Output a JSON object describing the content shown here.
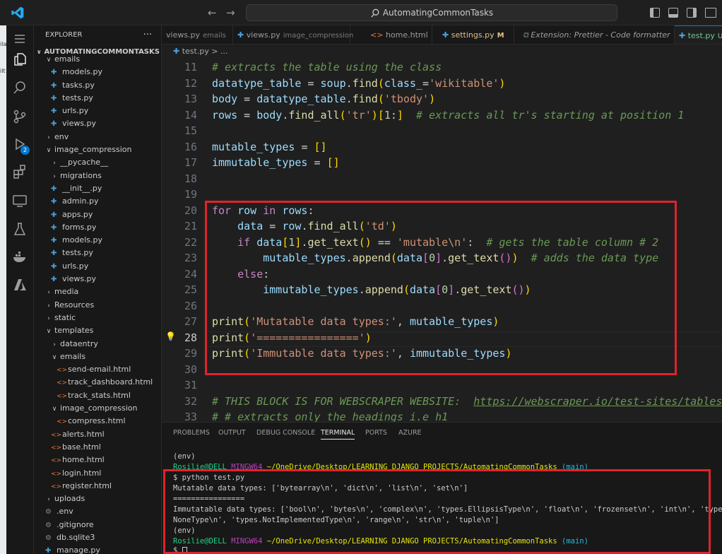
{
  "titlebar": {
    "search_text": "AutomatingCommonTasks",
    "back": "←",
    "forward": "→"
  },
  "left_strip": [
    "ila",
    "ilt"
  ],
  "explorer": {
    "header": "EXPLORER",
    "more": "···",
    "root": "AUTOMATINGCOMMONTASKS",
    "items": [
      {
        "label": "emails",
        "type": "folder-open",
        "indent": 1
      },
      {
        "label": "models.py",
        "type": "py",
        "indent": 2
      },
      {
        "label": "tasks.py",
        "type": "py",
        "indent": 2
      },
      {
        "label": "tests.py",
        "type": "py",
        "indent": 2
      },
      {
        "label": "urls.py",
        "type": "py",
        "indent": 2
      },
      {
        "label": "views.py",
        "type": "py",
        "indent": 2
      },
      {
        "label": "env",
        "type": "folder",
        "indent": 1
      },
      {
        "label": "image_compression",
        "type": "folder-open",
        "indent": 1
      },
      {
        "label": "__pycache__",
        "type": "folder",
        "indent": 2
      },
      {
        "label": "migrations",
        "type": "folder",
        "indent": 2
      },
      {
        "label": "__init__.py",
        "type": "py",
        "indent": 2
      },
      {
        "label": "admin.py",
        "type": "py",
        "indent": 2
      },
      {
        "label": "apps.py",
        "type": "py",
        "indent": 2
      },
      {
        "label": "forms.py",
        "type": "py",
        "indent": 2
      },
      {
        "label": "models.py",
        "type": "py",
        "indent": 2
      },
      {
        "label": "tests.py",
        "type": "py",
        "indent": 2
      },
      {
        "label": "urls.py",
        "type": "py",
        "indent": 2
      },
      {
        "label": "views.py",
        "type": "py",
        "indent": 2
      },
      {
        "label": "media",
        "type": "folder",
        "indent": 1
      },
      {
        "label": "Resources",
        "type": "folder",
        "indent": 1
      },
      {
        "label": "static",
        "type": "folder",
        "indent": 1
      },
      {
        "label": "templates",
        "type": "folder-open",
        "indent": 1
      },
      {
        "label": "dataentry",
        "type": "folder",
        "indent": 2
      },
      {
        "label": "emails",
        "type": "folder-open",
        "indent": 2
      },
      {
        "label": "send-email.html",
        "type": "html",
        "indent": 3
      },
      {
        "label": "track_dashboard.html",
        "type": "html",
        "indent": 3
      },
      {
        "label": "track_stats.html",
        "type": "html",
        "indent": 3
      },
      {
        "label": "image_compression",
        "type": "folder-open",
        "indent": 2
      },
      {
        "label": "compress.html",
        "type": "html",
        "indent": 3
      },
      {
        "label": "alerts.html",
        "type": "html",
        "indent": 2
      },
      {
        "label": "base.html",
        "type": "html",
        "indent": 2
      },
      {
        "label": "home.html",
        "type": "html",
        "indent": 2
      },
      {
        "label": "login.html",
        "type": "html",
        "indent": 2
      },
      {
        "label": "register.html",
        "type": "html",
        "indent": 2
      },
      {
        "label": "uploads",
        "type": "folder",
        "indent": 1
      },
      {
        "label": ".env",
        "type": "other",
        "indent": 1
      },
      {
        "label": ".gitignore",
        "type": "other",
        "indent": 1
      },
      {
        "label": "db.sqlite3",
        "type": "other",
        "indent": 1
      },
      {
        "label": "manage.py",
        "type": "py",
        "indent": 1
      }
    ]
  },
  "tabs": [
    {
      "label": "views.py",
      "desc": "emails",
      "icon": "py"
    },
    {
      "label": "views.py",
      "desc": "image_compression",
      "icon": "py"
    },
    {
      "label": "home.html",
      "desc": "",
      "icon": "html"
    },
    {
      "label": "settings.py",
      "desc": "M",
      "icon": "py"
    },
    {
      "label": "Extension: Prettier - Code formatter",
      "desc": "",
      "icon": "ext"
    },
    {
      "label": "test.py",
      "desc": "U",
      "icon": "py"
    }
  ],
  "breadcrumb": {
    "file": "test.py",
    "rest": "> ..."
  },
  "editor": {
    "line_numbers": [
      "11",
      "12",
      "13",
      "14",
      "15",
      "16",
      "17",
      "18",
      "19",
      "20",
      "21",
      "22",
      "23",
      "24",
      "25",
      "26",
      "27",
      "28",
      "29",
      "30",
      "31",
      "32",
      "33"
    ]
  },
  "panel": {
    "tabs": [
      "PROBLEMS",
      "OUTPUT",
      "DEBUG CONSOLE",
      "TERMINAL",
      "PORTS",
      "AZURE"
    ],
    "terminal": {
      "env1": "(env)",
      "user": "Rosilie@DELL",
      "host": "MINGW64",
      "path": "~/OneDrive/Desktop/LEARNING DJANGO PROJECTS/AutomatingCommonTasks",
      "branch": "(main)",
      "cmd": "$ python test.py",
      "out1": "Mutatable data types: ['bytearray\\n', 'dict\\n', 'list\\n', 'set\\n']",
      "out2": "================",
      "out3": "Immutatable data types: ['bool\\n', 'bytes\\n', 'complex\\n', 'types.EllipsisType\\n', 'float\\n', 'frozenset\\n', 'int\\n', 'types.",
      "out4": "NoneType\\n', 'types.NotImplementedType\\n', 'range\\n', 'str\\n', 'tuple\\n']",
      "env2": "(env)",
      "prompt": "$"
    }
  },
  "colors": {
    "accent": "#0078d4",
    "highlight_box": "#e0232b"
  }
}
